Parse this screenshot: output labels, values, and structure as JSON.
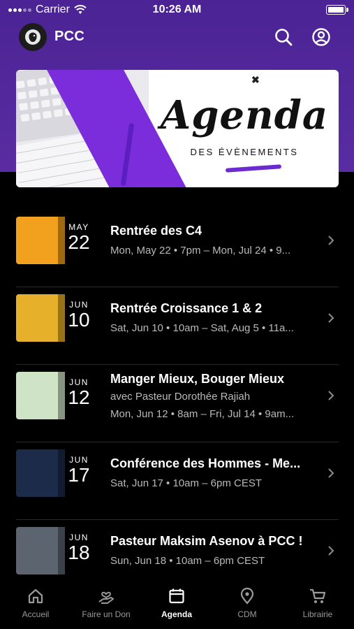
{
  "status_bar": {
    "carrier": "Carrier",
    "time": "10:26 AM"
  },
  "header": {
    "title": "PCC"
  },
  "banner": {
    "title": "Agenda",
    "subtitle": "DES ÉVÈNEMENTS"
  },
  "events": [
    {
      "title": "Rentrée des C4",
      "lines": [
        "Mon, May 22 • 7pm – Mon, Jul 24 • 9..."
      ],
      "thumb_month": "MAY",
      "thumb_day": "22",
      "thumb_color": "#f2a11e"
    },
    {
      "title": "Rentrée Croissance 1 & 2",
      "lines": [
        "Sat, Jun 10 • 10am – Sat, Aug 5 • 11a..."
      ],
      "thumb_month": "JUN",
      "thumb_day": "10",
      "thumb_color": "#e7b02a"
    },
    {
      "title": "Manger Mieux, Bouger Mieux",
      "lines": [
        "avec Pasteur Dorothée Rajiah",
        "Mon, Jun 12 • 8am – Fri, Jul 14 • 9am..."
      ],
      "thumb_month": "JUN",
      "thumb_day": "12",
      "thumb_color": "#cfe3c7"
    },
    {
      "title": "Conférence des Hommes - Me...",
      "lines": [
        "Sat, Jun 17 • 10am – 6pm CEST"
      ],
      "thumb_month": "JUN",
      "thumb_day": "17",
      "thumb_color": "#1d2b4a"
    },
    {
      "title": "Pasteur Maksim Asenov à PCC !",
      "lines": [
        "Sun, Jun 18 • 10am – 6pm CEST"
      ],
      "thumb_month": "JUN",
      "thumb_day": "18",
      "thumb_color": "#5c6470"
    }
  ],
  "tabs": [
    {
      "label": "Accueil",
      "icon": "home-icon",
      "active": false
    },
    {
      "label": "Faire un Don",
      "icon": "donate-hand-icon",
      "active": false
    },
    {
      "label": "Agenda",
      "icon": "calendar-icon",
      "active": true
    },
    {
      "label": "CDM",
      "icon": "location-pin-icon",
      "active": false
    },
    {
      "label": "Librairie",
      "icon": "cart-icon",
      "active": false
    }
  ],
  "colors": {
    "header_purple": "#4b2394",
    "accent_purple": "#7b2cdb",
    "background": "#000000"
  }
}
